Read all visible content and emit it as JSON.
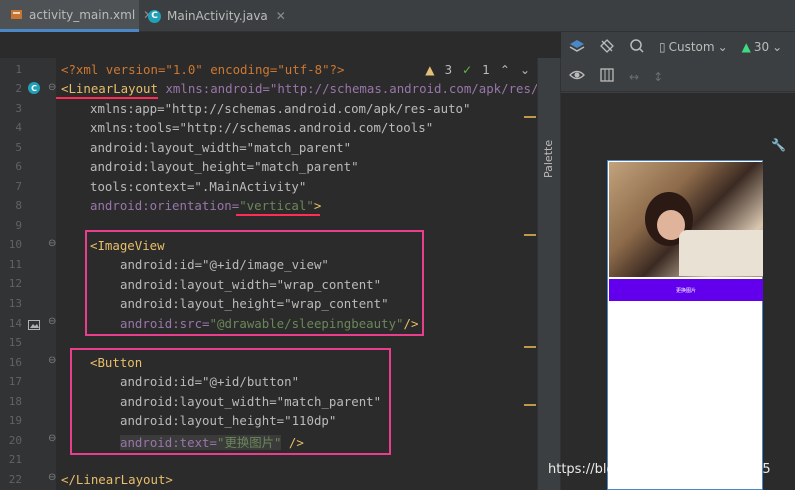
{
  "tabs": [
    {
      "label": "activity_main.xml",
      "active": true
    },
    {
      "label": "MainActivity.java",
      "active": false
    }
  ],
  "inspections": {
    "warnings": "3",
    "checks": "1"
  },
  "line_numbers": [
    "1",
    "2",
    "3",
    "4",
    "5",
    "6",
    "7",
    "8",
    "9",
    "10",
    "11",
    "12",
    "13",
    "14",
    "15",
    "16",
    "17",
    "18",
    "19",
    "20",
    "21",
    "22"
  ],
  "code": {
    "l1": "<?xml version=\"1.0\" encoding=\"utf-8\"?>",
    "l2_tag": "<LinearLayout",
    "l2_attr": " xmlns:android=\"http://schemas.android.com/apk/res/",
    "l3": "xmlns:app=\"http://schemas.android.com/apk/res-auto\"",
    "l4": "xmlns:tools=\"http://schemas.android.com/tools\"",
    "l5": "android:layout_width=\"match_parent\"",
    "l6": "android:layout_height=\"match_parent\"",
    "l7": "tools:context=\".MainActivity\"",
    "l8_attr": "android:orientation=",
    "l8_val": "\"vertical\"",
    "l8_end": ">",
    "l10": "<ImageView",
    "l11": "android:id=\"@+id/image_view\"",
    "l12": "android:layout_width=\"wrap_content\"",
    "l13": "android:layout_height=\"wrap_content\"",
    "l14_attr": "android:src=",
    "l14_val": "\"@drawable/sleepingbeauty\"",
    "l14_end": "/>",
    "l16": "<Button",
    "l17": "android:id=\"@+id/button\"",
    "l18": "android:layout_width=\"match_parent\"",
    "l19": "android:layout_height=\"110dp\"",
    "l20_attr": "android:text=",
    "l20_val": "\"更换图片\"",
    "l20_end": " />",
    "l22": "</LinearLayout>"
  },
  "palette_label": "Palette",
  "design_toolbar": {
    "device": "Custom",
    "api": "30"
  },
  "preview_button_text": "更换图片",
  "watermark": "https://blog.csdn.net/Scarlett2025",
  "accent_colors": {
    "tab_indicator": "#4a88c7",
    "highlight_box": "#e83e8c",
    "button": "#6200ee"
  }
}
